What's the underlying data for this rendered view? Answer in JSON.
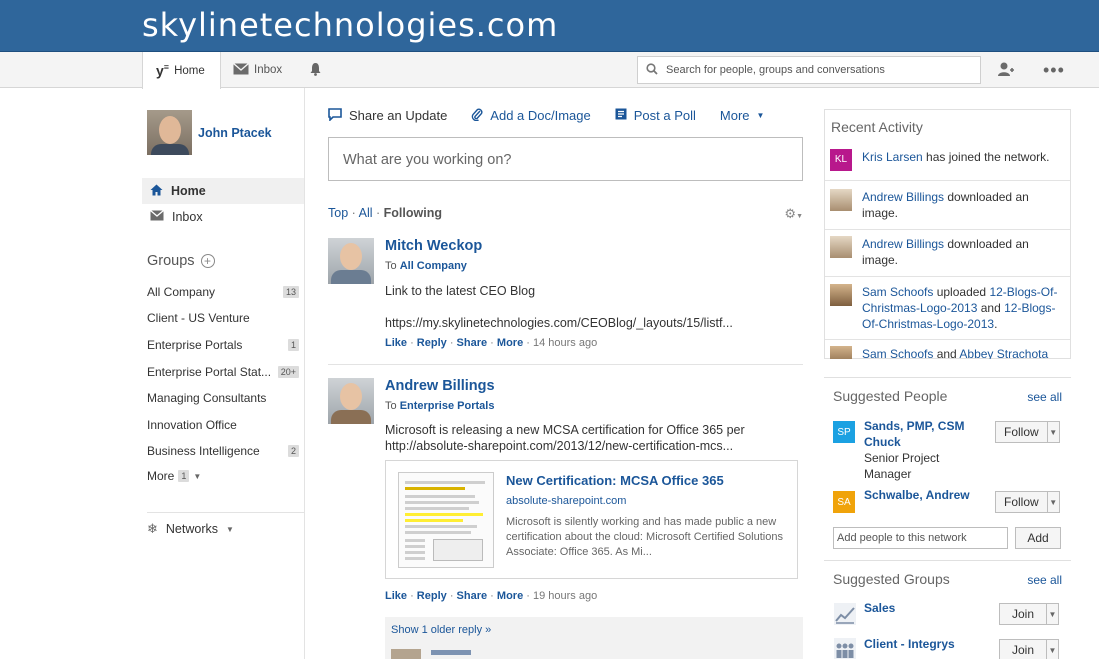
{
  "banner": {
    "title": "skylinetechnologies.com"
  },
  "topnav": {
    "home_label": "Home",
    "inbox_label": "Inbox",
    "search_placeholder": "Search for people, groups and conversations"
  },
  "sidebar": {
    "user_name": "John Ptacek",
    "nav": [
      {
        "label": "Home"
      },
      {
        "label": "Inbox"
      }
    ],
    "groups_heading": "Groups",
    "groups": [
      {
        "name": "All Company",
        "badge": "13"
      },
      {
        "name": "Client - US Venture",
        "badge": ""
      },
      {
        "name": "Enterprise Portals",
        "badge": "1"
      },
      {
        "name": "Enterprise Portal Stat...",
        "badge": "20+"
      },
      {
        "name": "Managing Consultants",
        "badge": ""
      },
      {
        "name": "Innovation Office",
        "badge": ""
      },
      {
        "name": "Business Intelligence",
        "badge": "2"
      }
    ],
    "more_label": "More",
    "more_badge": "1",
    "networks_label": "Networks"
  },
  "composer": {
    "tabs": [
      "Share an Update",
      "Add a Doc/Image",
      "Post a Poll",
      "More"
    ],
    "placeholder": "What are you working on?"
  },
  "feed_filter": {
    "top": "Top",
    "all": "All",
    "following": "Following",
    "sep": "·"
  },
  "posts": [
    {
      "author": "Mitch Weckop",
      "to_prefix": "To",
      "to_group": "All Company",
      "text": "Link to the latest CEO Blog",
      "link": "https://my.skylinetechnologies.com/CEOBlog/_layouts/15/listf...",
      "actions": {
        "like": "Like",
        "reply": "Reply",
        "share": "Share",
        "more": "More"
      },
      "time": "14 hours ago"
    },
    {
      "author": "Andrew Billings",
      "to_prefix": "To",
      "to_group": "Enterprise Portals",
      "text": "Microsoft is releasing a new MCSA certification for Office 365 per",
      "link": "http://absolute-sharepoint.com/2013/12/new-certification-mcs...",
      "attachment": {
        "title": "New Certification: MCSA Office 365",
        "domain": "absolute-sharepoint.com",
        "description": "Microsoft is silently working and has made public a new certification about the cloud: Microsoft Certified Solutions Associate: Office 365. As Mi..."
      },
      "actions": {
        "like": "Like",
        "reply": "Reply",
        "share": "Share",
        "more": "More"
      },
      "time": "19 hours ago",
      "older_replies": "Show 1 older reply »"
    }
  ],
  "recent_activity": {
    "title": "Recent Activity",
    "items": [
      {
        "initials": "KL",
        "actor": "Kris Larsen",
        "text": " has joined the network."
      },
      {
        "actor": "Andrew Billings",
        "text": " downloaded an image."
      },
      {
        "actor": "Andrew Billings",
        "text": " downloaded an image."
      },
      {
        "actor": "Sam Schoofs",
        "text": " uploaded ",
        "object": "12-Blogs-Of-Christmas-Logo-2013",
        "and": " and ",
        "object2": "12-Blogs-Of-Christmas-Logo-2013",
        "end": "."
      },
      {
        "actor": "Sam Schoofs",
        "and": " and ",
        "actor2": "Abbey Strachota"
      }
    ]
  },
  "suggested_people": {
    "title": "Suggested People",
    "see_all": "see all",
    "people": [
      {
        "initials": "SP",
        "name_line1": "Sands, PMP, CSM",
        "name_line2": "Chuck",
        "title_line1": "Senior Project",
        "title_line2": "Manager",
        "button": "Follow",
        "color": "#1ba1e2"
      },
      {
        "initials": "SA",
        "name_line1": "Schwalbe, Andrew",
        "button": "Follow",
        "color": "#f0a30a"
      }
    ],
    "add_placeholder": "Add people to this network",
    "add_button": "Add"
  },
  "suggested_groups": {
    "title": "Suggested Groups",
    "see_all": "see all",
    "groups": [
      {
        "name": "Sales",
        "button": "Join"
      },
      {
        "name": "Client - Integrys",
        "button": "Join"
      }
    ]
  }
}
